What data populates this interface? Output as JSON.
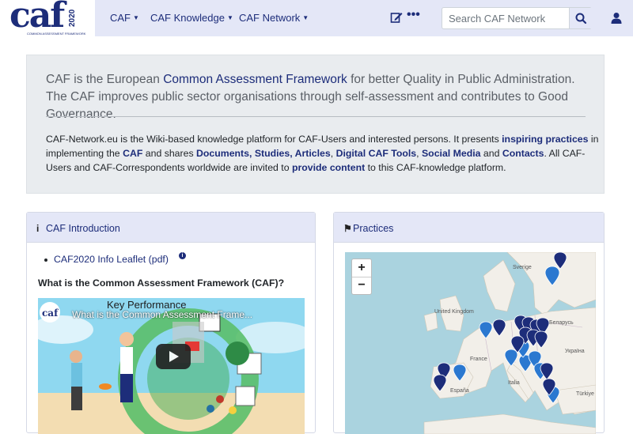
{
  "logo": {
    "text": "caf",
    "year": "2020",
    "subtitle": "COMMON ASSESSMENT FRAMEWORK"
  },
  "nav": {
    "items": [
      {
        "label": "CAF"
      },
      {
        "label": "CAF Knowledge"
      },
      {
        "label": "CAF Network"
      }
    ],
    "edit_icon": "edit-icon",
    "more_icon": "ellipsis-icon",
    "search_placeholder": "Search CAF Network",
    "search_icon": "search-icon",
    "user_icon": "user-icon"
  },
  "intro": {
    "lead_before": "CAF is the European ",
    "lead_link": "Common Assessment Framework",
    "lead_after": " for better Quality in Public Administration. The CAF improves public sector organisations through self-assessment and contributes to Good Governance.",
    "desc": {
      "t1": "CAF-Network.eu is the Wiki-based knowledge platform for CAF-Users and interested persons. It presents ",
      "l1": "inspiring practices",
      "t2": " in implementing the ",
      "l2": "CAF",
      "t3": " and shares ",
      "l3": "Documents, Studies, Articles",
      "t4": ", ",
      "l4": "Digital CAF Tools",
      "t5": ", ",
      "l5": "Social Media",
      "t6": " and ",
      "l6": "Contacts",
      "t7": ". All CAF-Users and CAF-Correspondents worldwide are invited to ",
      "l7": "provide content",
      "t8": " to this CAF-knowledge platform."
    }
  },
  "caf_intro": {
    "header": "CAF Introduction",
    "leaflet": "CAF2020 Info Leaflet (pdf)",
    "question": "What is the Common Assessment Framework (CAF)?",
    "video_title": "What is the Common Assessment Frame...",
    "video_overlay": "Key Performance"
  },
  "practices": {
    "header": "Practices",
    "zoom_in": "+",
    "zoom_out": "−",
    "labels": [
      "Sverige",
      "United Kingdom",
      "Беларусь",
      "Україна",
      "France",
      "Italia",
      "España",
      "Türkiye"
    ]
  },
  "colors": {
    "brand": "#1d2d7a",
    "nav_bg": "#e4e7f7",
    "panel_bg": "#e9ecef",
    "marker": "#2b78d0",
    "marker_dark": "#1d2d7a"
  }
}
